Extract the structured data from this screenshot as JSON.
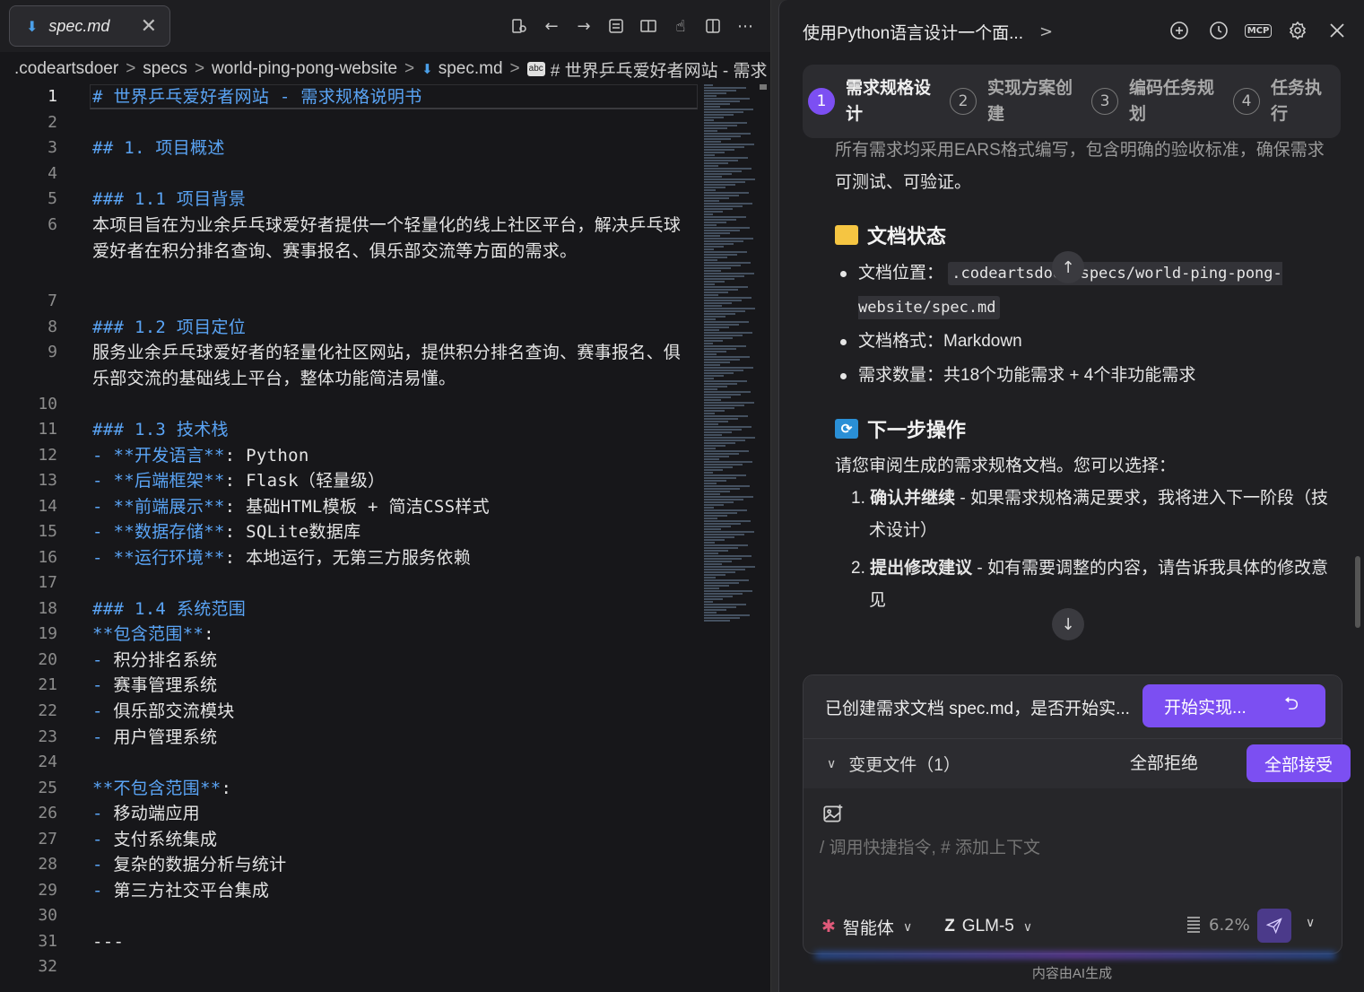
{
  "editor": {
    "tab_label": "spec.md",
    "breadcrumb": [
      ".codeartsdoer",
      "specs",
      "world-ping-pong-website",
      "spec.md",
      "# 世界乒乓爱好者网站 - 需求"
    ],
    "lines": [
      {
        "n": "1",
        "t": "# 世界乒乓爱好者网站 - 需求规格说明书"
      },
      {
        "n": "2",
        "t": ""
      },
      {
        "n": "3",
        "t": "## 1. 项目概述"
      },
      {
        "n": "4",
        "t": ""
      },
      {
        "n": "5",
        "t": "### 1.1 项目背景"
      },
      {
        "n": "6",
        "t": "本项目旨在为业余乒乓球爱好者提供一个轻量化的线上社区平台，解决乒乓球爱好者在积分排名查询、赛事报名、俱乐部交流等方面的需求。"
      },
      {
        "n": "7",
        "t": ""
      },
      {
        "n": "8",
        "t": "### 1.2 项目定位"
      },
      {
        "n": "9",
        "t": "服务业余乒乓球爱好者的轻量化社区网站，提供积分排名查询、赛事报名、俱乐部交流的基础线上平台，整体功能简洁易懂。"
      },
      {
        "n": "10",
        "t": ""
      },
      {
        "n": "11",
        "t": "### 1.3 技术栈"
      },
      {
        "n": "12",
        "pre": "- **开发语言**",
        "t": ": Python"
      },
      {
        "n": "13",
        "pre": "- **后端框架**",
        "t": ": Flask（轻量级）"
      },
      {
        "n": "14",
        "pre": "- **前端展示**",
        "t": ": 基础HTML模板 + 简洁CSS样式"
      },
      {
        "n": "15",
        "pre": "- **数据存储**",
        "t": ": SQLite数据库"
      },
      {
        "n": "16",
        "pre": "- **运行环境**",
        "t": ": 本地运行，无第三方服务依赖"
      },
      {
        "n": "17",
        "t": ""
      },
      {
        "n": "18",
        "t": "### 1.4 系统范围"
      },
      {
        "n": "19",
        "pre": "**包含范围**",
        "t": ":"
      },
      {
        "n": "20",
        "pre": "- ",
        "t": "积分排名系统"
      },
      {
        "n": "21",
        "pre": "- ",
        "t": "赛事管理系统"
      },
      {
        "n": "22",
        "pre": "- ",
        "t": "俱乐部交流模块"
      },
      {
        "n": "23",
        "pre": "- ",
        "t": "用户管理系统"
      },
      {
        "n": "24",
        "t": ""
      },
      {
        "n": "25",
        "pre": "**不包含范围**",
        "t": ":"
      },
      {
        "n": "26",
        "pre": "- ",
        "t": "移动端应用"
      },
      {
        "n": "27",
        "pre": "- ",
        "t": "支付系统集成"
      },
      {
        "n": "28",
        "pre": "- ",
        "t": "复杂的数据分析与统计"
      },
      {
        "n": "29",
        "pre": "- ",
        "t": "第三方社交平台集成"
      },
      {
        "n": "30",
        "t": ""
      },
      {
        "n": "31",
        "t": "---"
      },
      {
        "n": "32",
        "t": ""
      }
    ]
  },
  "chat": {
    "title": "使用Python语言设计一个面...",
    "steps": [
      {
        "num": "1",
        "label": "需求规格设计",
        "active": true
      },
      {
        "num": "2",
        "label": "实现方案创建",
        "active": false
      },
      {
        "num": "3",
        "label": "编码任务规划",
        "active": false
      },
      {
        "num": "4",
        "label": "任务执行",
        "active": false
      }
    ],
    "intro_faded": "所有需求均采用EARS格式编写，包含明确的验收标准，确保需求",
    "intro_rest": "可测试、可验证。",
    "doc_status_title": "文档状态",
    "doc_status": {
      "location_label": "文档位置：",
      "location_value": ".codeartsdoer/specs/world-ping-pong-website/spec.md",
      "format": "文档格式：Markdown",
      "count": "需求数量：共18个功能需求 + 4个非功能需求"
    },
    "next_title": "下一步操作",
    "next_intro": "请您审阅生成的需求规格文档。您可以选择：",
    "options": [
      {
        "num": "1.",
        "bold": "确认并继续",
        "rest": " - 如果需求规格满足要求，我将进入下一阶段（技术设计）"
      },
      {
        "num": "2.",
        "bold": "提出修改建议",
        "rest": " - 如有需要调整的内容，请告诉我具体的修改意见"
      }
    ],
    "confirm_text": "已创建需求文档 spec.md，是否开始实...",
    "start_button": "开始实现...",
    "changes_label": "变更文件（1）",
    "reject_all": "全部拒绝",
    "accept_all": "全部接受",
    "prompt_placeholder": "/ 调用快捷指令, # 添加上下文",
    "agent_label": "智能体",
    "model_label": "GLM-5",
    "usage": "6.2%",
    "footer_note": "内容由AI生成"
  },
  "colors": {
    "accent": "#7c4ff2",
    "heading": "#5aa4f5"
  }
}
